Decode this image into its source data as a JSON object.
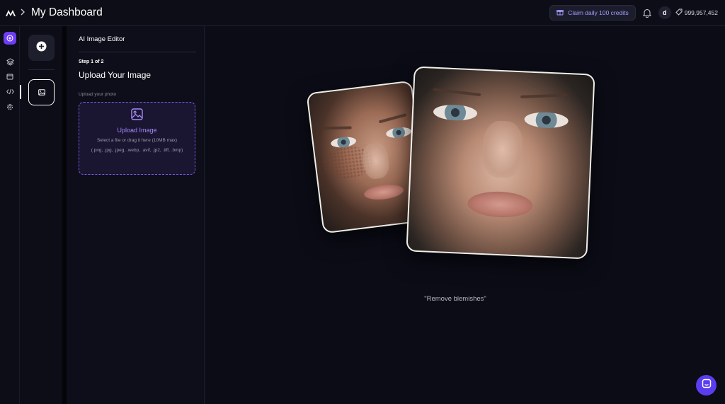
{
  "header": {
    "title": "My Dashboard",
    "claim_label": "Claim daily 100 credits",
    "avatar_initial": "d",
    "credits": "999,957,452"
  },
  "rail": {
    "items": [
      "create-icon",
      "layers-icon",
      "wallet-icon",
      "code-icon",
      "settings-icon"
    ],
    "active_color": "#6d3df5"
  },
  "tools": {
    "items": [
      "add-icon",
      "image-icon"
    ]
  },
  "panel": {
    "title": "AI Image Editor",
    "step": "Step 1 of 2",
    "heading": "Upload Your Image",
    "field_label": "Upload your photo",
    "upload": {
      "title": "Upload Image",
      "subtitle": "Select a file or drag it here (10MB max)",
      "formats": "(.png, .jpg, .jpeg, .webp, .avif, .jp2, .tiff, .bmp)"
    }
  },
  "canvas": {
    "caption": "\"Remove blemishes\""
  },
  "colors": {
    "accent": "#7c5cf6",
    "background": "#0c0d16"
  }
}
